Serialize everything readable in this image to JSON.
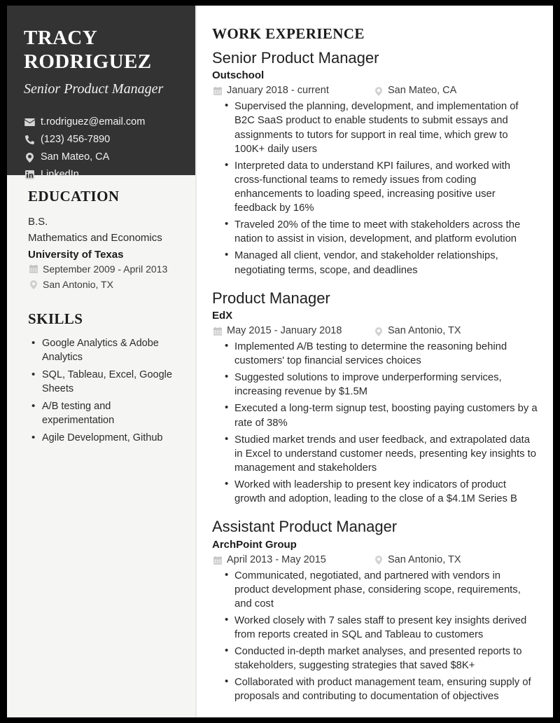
{
  "colors": {
    "page_border": "#000000",
    "sidebar_header_bg": "#333333",
    "sidebar_body_bg": "#f5f5f4",
    "main_bg": "#ffffff",
    "heading_text": "#1b1b1b",
    "body_text": "#2b2b2b",
    "meta_text": "#3a3a3a",
    "icon_muted": "#c9c9c9",
    "sidebar_text": "#f2f2f2"
  },
  "sidebar": {
    "name": "TRACY RODRIGUEZ",
    "job_title": "Senior Product Manager",
    "contacts": [
      {
        "icon": "envelope-icon",
        "label": "t.rodriguez@email.com",
        "is_link": false
      },
      {
        "icon": "phone-icon",
        "label": "(123) 456-7890",
        "is_link": false
      },
      {
        "icon": "location-pin-icon",
        "label": "San Mateo, CA",
        "is_link": false
      },
      {
        "icon": "linkedin-icon",
        "label": "LinkedIn",
        "is_link": true
      }
    ],
    "education": {
      "heading": "EDUCATION",
      "degree": "B.S.",
      "field": "Mathematics and Economics",
      "school": "University of Texas",
      "dates": "September 2009 - April 2013",
      "location": "San Antonio, TX"
    },
    "skills": {
      "heading": "SKILLS",
      "items": [
        "Google Analytics & Adobe Analytics",
        "SQL, Tableau, Excel, Google Sheets",
        "A/B testing and experimentation",
        "Agile Development, Github"
      ]
    }
  },
  "main": {
    "heading": "WORK EXPERIENCE",
    "jobs": [
      {
        "title": "Senior Product Manager",
        "company": "Outschool",
        "dates": "January 2018 - current",
        "location": "San Mateo, CA",
        "bullets": [
          "Supervised the planning, development, and implementation of B2C SaaS product to enable students to submit essays and assignments to tutors for support in real time, which grew to 100K+ daily users",
          "Interpreted data to understand KPI failures, and worked with cross-functional teams to remedy issues from coding enhancements to loading speed, increasing positive user feedback by 16%",
          "Traveled 20% of the time to meet with stakeholders across the nation to assist in vision, development, and platform evolution",
          "Managed all client, vendor, and stakeholder relationships, negotiating terms, scope, and deadlines"
        ]
      },
      {
        "title": "Product Manager",
        "company": "EdX",
        "dates": "May 2015 - January 2018",
        "location": "San Antonio, TX",
        "bullets": [
          "Implemented A/B testing to determine the reasoning behind customers' top financial services choices",
          "Suggested solutions to improve underperforming services, increasing revenue by $1.5M",
          "Executed a long-term signup test, boosting paying customers by a rate of 38%",
          "Studied market trends and user feedback, and extrapolated data in Excel to understand customer needs, presenting key insights to management and stakeholders",
          "Worked with leadership to present key indicators of product growth and adoption, leading to the close of a $4.1M Series B"
        ]
      },
      {
        "title": "Assistant Product Manager",
        "company": "ArchPoint Group",
        "dates": "April 2013 - May 2015",
        "location": "San Antonio, TX",
        "bullets": [
          "Communicated, negotiated, and partnered with vendors in product development phase, considering scope, requirements, and cost",
          "Worked closely with 7 sales staff to present key insights derived from reports created in SQL and Tableau to customers",
          "Conducted in-depth market analyses, and presented reports to stakeholders, suggesting strategies that saved $8K+",
          "Collaborated with product management team, ensuring supply of proposals and contributing to documentation of objectives"
        ]
      }
    ]
  }
}
